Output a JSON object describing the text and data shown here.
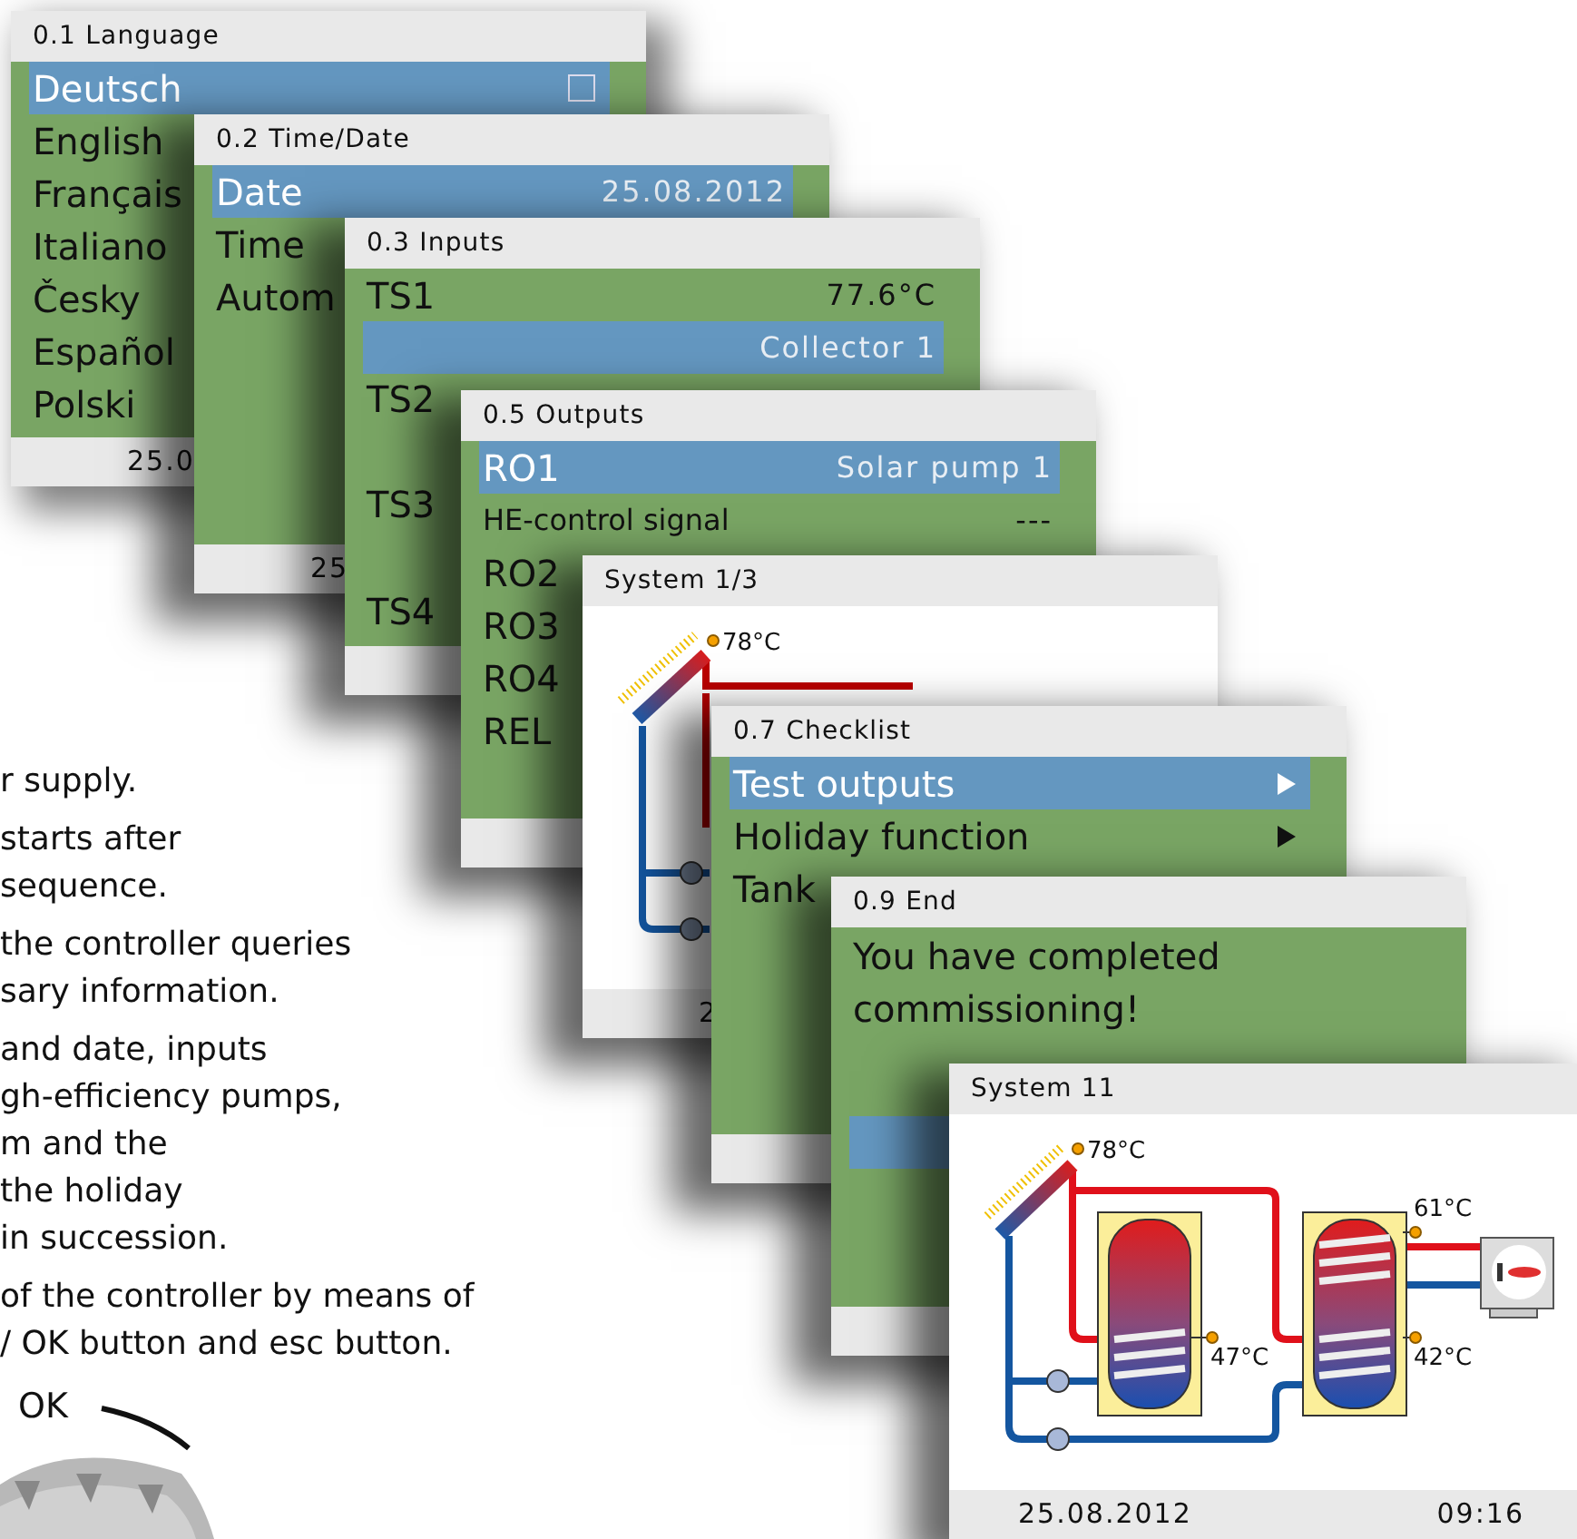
{
  "manual_text": [
    {
      "lines": [
        "r supply."
      ]
    },
    {
      "lines": [
        "starts after",
        "sequence."
      ]
    },
    {
      "lines": [
        "the controller queries",
        "sary information."
      ]
    },
    {
      "lines": [
        "and date, inputs",
        "gh-efficiency pumps,",
        "m and the",
        "the holiday",
        "in succession."
      ]
    },
    {
      "lines": [
        "of the controller by means of",
        "/ OK button and esc button."
      ]
    }
  ],
  "dial": {
    "label": "OK"
  },
  "screens": [
    {
      "title": "0.1 Language",
      "kind": "menu",
      "rows": [
        {
          "kind": "checkbox",
          "label": "Deutsch",
          "selected": true,
          "checked": false
        },
        {
          "kind": "item",
          "label": "English",
          "selected": false
        },
        {
          "kind": "item",
          "label": "Français",
          "selected": false
        },
        {
          "kind": "item",
          "label": "Italiano",
          "selected": false
        },
        {
          "kind": "item",
          "label": "Česky",
          "selected": false
        },
        {
          "kind": "item",
          "label": "Español",
          "selected": false
        },
        {
          "kind": "item",
          "label": "Polski",
          "selected": false
        }
      ],
      "footer": [
        "25.0"
      ]
    },
    {
      "title": "0.2 Time/Date",
      "kind": "menu",
      "rows": [
        {
          "kind": "item",
          "label": "Date",
          "value": "25.08.2012",
          "selected": true
        },
        {
          "kind": "item",
          "label": "Time",
          "selected": false
        },
        {
          "kind": "item",
          "label": "Autom",
          "selected": false
        }
      ],
      "footer": [
        "25"
      ]
    },
    {
      "title": "0.3 Inputs",
      "kind": "menu",
      "rows": [
        {
          "kind": "item",
          "label": "TS1",
          "value": "77.6°C",
          "selected": false
        },
        {
          "kind": "item",
          "value": "Collector 1",
          "selected": true
        },
        {
          "kind": "sensor",
          "label": "TS2",
          "selected": false
        },
        {
          "kind": "sensor",
          "label": "TS3",
          "selected": false
        },
        {
          "kind": "item",
          "label": "TS4",
          "selected": false
        }
      ]
    },
    {
      "title": "0.5 Outputs",
      "kind": "menu",
      "rows": [
        {
          "kind": "item",
          "label": "RO1",
          "value": "Solar pump 1",
          "selected": true
        },
        {
          "kind": "small",
          "label": "HE-control signal",
          "value": "---",
          "selected": false
        },
        {
          "kind": "item",
          "label": "RO2",
          "selected": false
        },
        {
          "kind": "item",
          "label": "RO3",
          "selected": false
        },
        {
          "kind": "item",
          "label": "RO4",
          "selected": false
        },
        {
          "kind": "item",
          "label": "REL",
          "selected": false
        }
      ]
    },
    {
      "title": "System 1/3",
      "kind": "system",
      "labels": [
        "78°C"
      ],
      "footer": [
        "2"
      ]
    },
    {
      "title": "0.7 Checklist",
      "kind": "menu",
      "rows": [
        {
          "kind": "submenu",
          "label": "Test outputs",
          "selected": true
        },
        {
          "kind": "submenu",
          "label": "Holiday function",
          "selected": false
        },
        {
          "kind": "item",
          "label": "Tank",
          "selected": false
        }
      ]
    },
    {
      "title": "0.9 End",
      "kind": "menu",
      "message": "You have completed commissioning!",
      "rows": [
        {
          "kind": "blank",
          "selected": true
        }
      ]
    },
    {
      "title": "System 11",
      "kind": "system2",
      "labels": [
        "78°C",
        "47°C",
        "61°C",
        "42°C"
      ],
      "footer": [
        "25.08.2012",
        "09:16"
      ]
    }
  ]
}
